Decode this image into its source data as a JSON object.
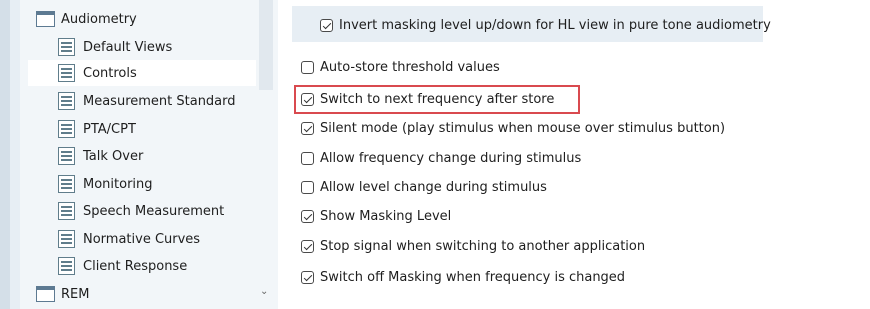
{
  "tree": {
    "items": [
      {
        "label": "Audiometry",
        "icon": "folder-icon",
        "level": 0,
        "selected": false
      },
      {
        "label": "Default Views",
        "icon": "page-icon",
        "level": 1,
        "selected": false
      },
      {
        "label": "Controls",
        "icon": "page-icon",
        "level": 1,
        "selected": true
      },
      {
        "label": "Measurement Standard",
        "icon": "page-icon",
        "level": 1,
        "selected": false
      },
      {
        "label": "PTA/CPT",
        "icon": "page-icon",
        "level": 1,
        "selected": false
      },
      {
        "label": "Talk Over",
        "icon": "page-icon",
        "level": 1,
        "selected": false
      },
      {
        "label": "Monitoring",
        "icon": "page-icon",
        "level": 1,
        "selected": false
      },
      {
        "label": "Speech Measurement",
        "icon": "page-icon",
        "level": 1,
        "selected": false
      },
      {
        "label": "Normative Curves",
        "icon": "page-icon",
        "level": 1,
        "selected": false
      },
      {
        "label": "Client Response",
        "icon": "page-icon",
        "level": 1,
        "selected": false
      },
      {
        "label": "REM",
        "icon": "folder-icon",
        "level": 0,
        "selected": false
      }
    ],
    "scroll_arrow": "⌄"
  },
  "settings": {
    "top_option": {
      "label": "Invert masking level up/down for HL view in pure tone audiometry",
      "checked": true
    },
    "options": [
      {
        "label": "Auto-store threshold values",
        "checked": false
      },
      {
        "label": "Switch to next frequency after store",
        "checked": true,
        "highlighted": true
      },
      {
        "label": "Silent mode (play stimulus when mouse over stimulus button)",
        "checked": true
      },
      {
        "label": "Allow frequency change during stimulus",
        "checked": false
      },
      {
        "label": "Allow level change during stimulus",
        "checked": false
      },
      {
        "label": "Show Masking Level",
        "checked": true
      },
      {
        "label": "Stop signal when switching to another application",
        "checked": true
      },
      {
        "label": "Switch off Masking when frequency is changed",
        "checked": true
      }
    ]
  },
  "colors": {
    "highlight_border": "#d94a4f",
    "tree_background": "#f2f6f9",
    "selected_background": "#ffffff",
    "top_box_background": "#e7eef4"
  }
}
